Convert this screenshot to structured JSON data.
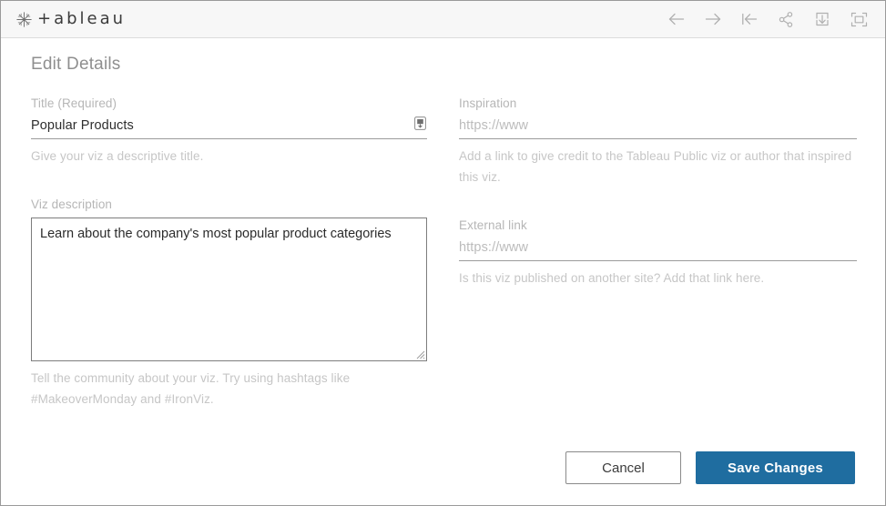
{
  "header": {
    "brand_text": "+ableau",
    "brand_mark_icon": "tableau-asterisk-logo",
    "tools": [
      {
        "name": "back-arrow-icon",
        "label": "Back"
      },
      {
        "name": "forward-arrow-icon",
        "label": "Forward"
      },
      {
        "name": "go-to-start-icon",
        "label": "Go to start"
      },
      {
        "name": "share-icon",
        "label": "Share"
      },
      {
        "name": "download-icon",
        "label": "Download"
      },
      {
        "name": "fullscreen-icon",
        "label": "Full screen"
      }
    ]
  },
  "dialog": {
    "title": "Edit Details"
  },
  "fields": {
    "title": {
      "label": "Title (Required)",
      "value": "Popular Products",
      "hint": "Give your viz a descriptive title.",
      "badge_icon": "text-input-badge-icon"
    },
    "description": {
      "label": "Viz description",
      "value": "Learn about the company's most popular product categories",
      "hint": "Tell the community about your viz. Try using hashtags like #MakeoverMonday and #IronViz."
    },
    "inspiration": {
      "label": "Inspiration",
      "value": "",
      "placeholder": "https://www",
      "hint": "Add a link to give credit to the Tableau Public viz or author that inspired this viz."
    },
    "external_link": {
      "label": "External link",
      "value": "",
      "placeholder": "https://www",
      "hint": "Is this viz published on another site? Add that link here."
    }
  },
  "actions": {
    "cancel_label": "Cancel",
    "save_label": "Save Changes"
  },
  "colors": {
    "accent_blue": "#1f6da0",
    "header_bg": "#f7f7f7",
    "label_gray": "#b6b6b6",
    "hint_gray": "#c6c6c6"
  }
}
